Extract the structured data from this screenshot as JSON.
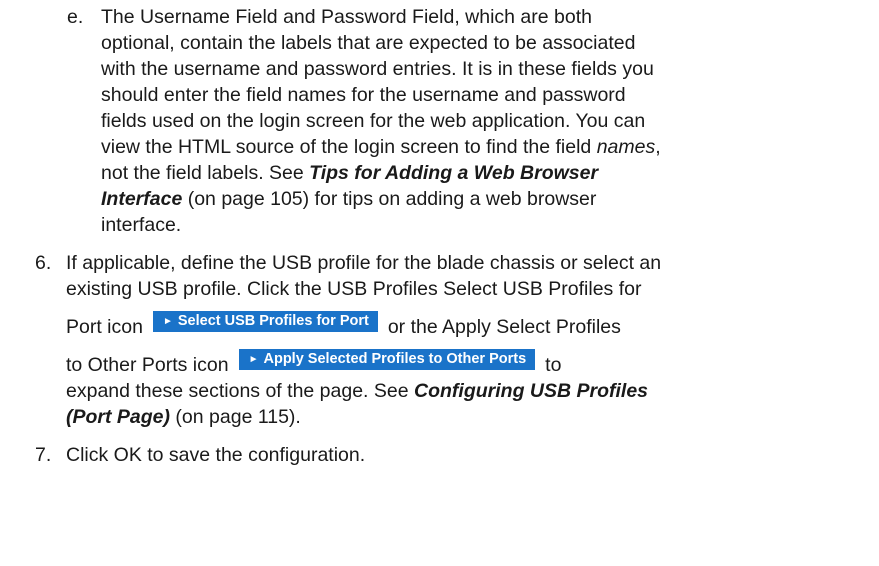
{
  "item_e": {
    "marker": "e.",
    "l1": "The Username Field and Password Field, which are both",
    "l2": "optional, contain the labels that are expected to be associated",
    "l3": "with the username and password entries. It is in these fields you",
    "l4": "should enter the field names for the username and password",
    "l5": "fields used on the login screen for the web application. You can",
    "l6_a": "view the HTML source of the login screen to find the field ",
    "l6_b": "names",
    "l6_c": ",",
    "l7": "not the field labels. See ",
    "link_a": "Tips for Adding a Web Browser",
    "link_b": "Interface",
    "l8_rest": " (on page 105) for tips on adding a web browser",
    "l9": "interface."
  },
  "item_6": {
    "marker": "6.",
    "l1": "If applicable, define the USB profile for the blade chassis or select an",
    "l2": "existing USB profile. Click the USB Profiles Select USB Profiles for",
    "l3_pre": "Port icon",
    "button1": "Select USB Profiles for Port",
    "l3_post": "or the Apply Select Profiles",
    "l4_pre": "to Other Ports icon",
    "button2": "Apply Selected Profiles to Other Ports",
    "l4_post": "to",
    "l5_pre": "expand these sections of the page. See ",
    "link_a": "Configuring USB Profiles",
    "link_b": "(Port Page)",
    "l6_rest": " (on page 115)."
  },
  "item_7": {
    "marker": "7.",
    "text": "Click OK to save the configuration."
  },
  "icons": {
    "button_arrow": "play-triangle-icon"
  },
  "colors": {
    "button_bg": "#1a73c9",
    "button_text": "#ffffff",
    "text": "#1a1a1a"
  }
}
